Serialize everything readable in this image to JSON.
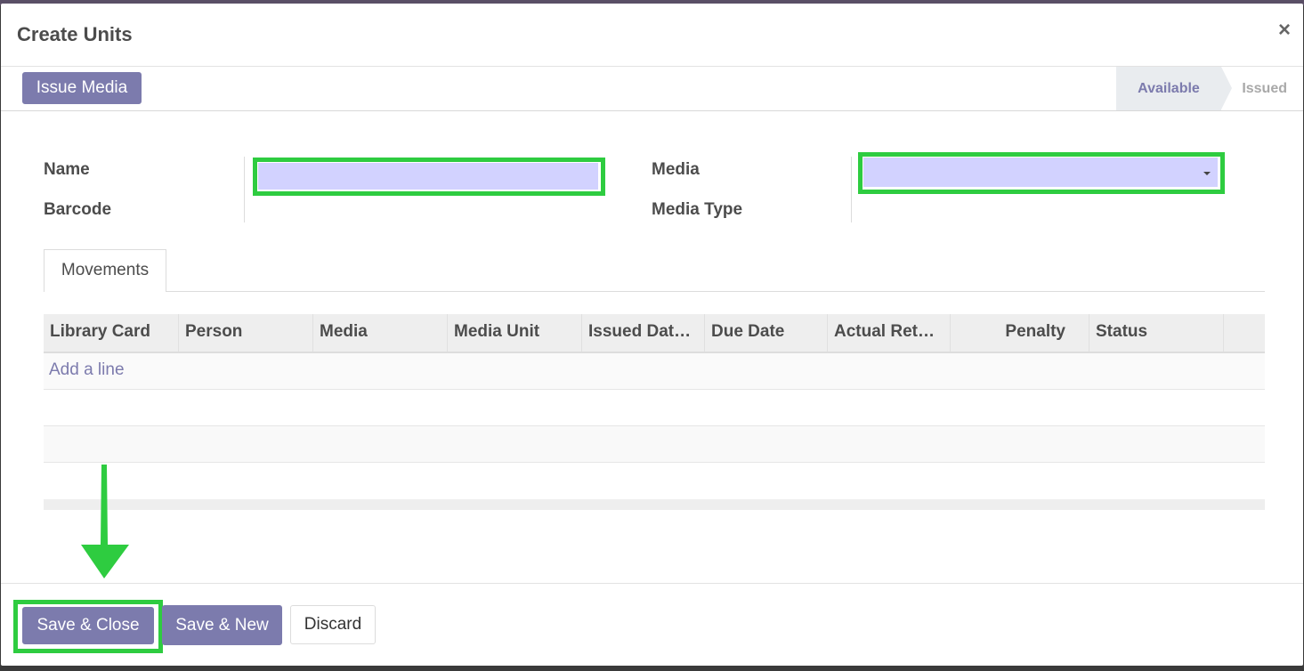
{
  "dialog": {
    "title": "Create Units",
    "close_label": "×"
  },
  "statusbar": {
    "issue_button": "Issue Media",
    "stages": [
      "Available",
      "Issued"
    ],
    "active_stage": "Available"
  },
  "form": {
    "name_label": "Name",
    "barcode_label": "Barcode",
    "media_label": "Media",
    "media_type_label": "Media Type",
    "name_value": "",
    "media_value": ""
  },
  "notebook": {
    "tabs": [
      "Movements"
    ]
  },
  "table": {
    "columns": [
      "Library Card",
      "Person",
      "Media",
      "Media Unit",
      "Issued Dat…",
      "Due Date",
      "Actual Ret…",
      "Penalty",
      "Status"
    ],
    "add_line": "Add a line",
    "rows": []
  },
  "footer": {
    "save_close": "Save & Close",
    "save_new": "Save & New",
    "discard": "Discard"
  },
  "colors": {
    "primary": "#7c7bad",
    "highlight": "#2ecc40",
    "input_fill": "#d2d2ff"
  }
}
